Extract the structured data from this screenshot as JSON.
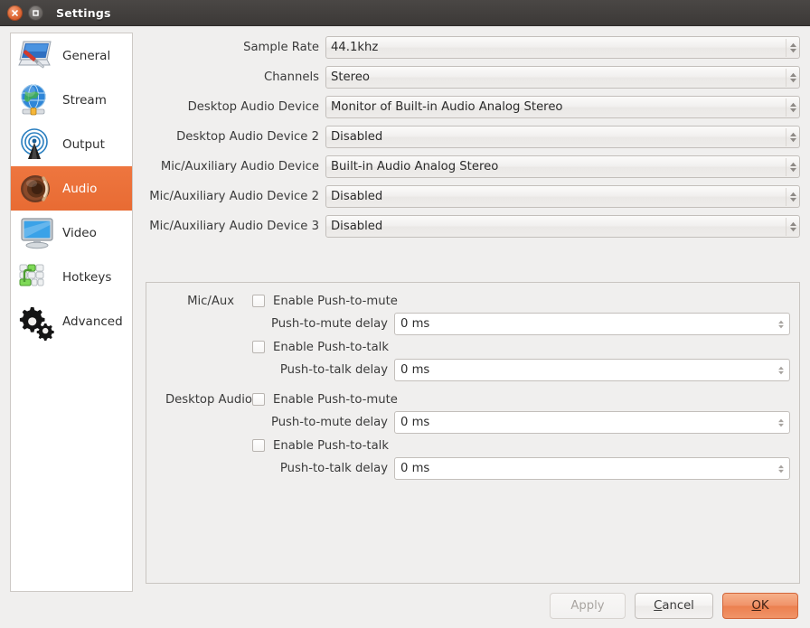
{
  "window": {
    "title": "Settings",
    "close_icon": "close-icon",
    "maximize_icon": "maximize-icon"
  },
  "colors": {
    "accent": "#e8713c",
    "titlebar": "#3c3937",
    "panel_bg": "#f0efee",
    "field_border": "#c3bfbb"
  },
  "sidebar": {
    "items": [
      {
        "label": "General",
        "icon": "general-icon",
        "selected": false
      },
      {
        "label": "Stream",
        "icon": "stream-icon",
        "selected": false
      },
      {
        "label": "Output",
        "icon": "output-icon",
        "selected": false
      },
      {
        "label": "Audio",
        "icon": "audio-icon",
        "selected": true
      },
      {
        "label": "Video",
        "icon": "video-icon",
        "selected": false
      },
      {
        "label": "Hotkeys",
        "icon": "hotkeys-icon",
        "selected": false
      },
      {
        "label": "Advanced",
        "icon": "advanced-icon",
        "selected": false
      }
    ]
  },
  "form": {
    "rows": [
      {
        "label": "Sample Rate",
        "value": "44.1khz"
      },
      {
        "label": "Channels",
        "value": "Stereo"
      },
      {
        "label": "Desktop Audio Device",
        "value": "Monitor of Built-in Audio Analog Stereo"
      },
      {
        "label": "Desktop Audio Device 2",
        "value": "Disabled"
      },
      {
        "label": "Mic/Auxiliary Audio Device",
        "value": "Built-in Audio Analog Stereo"
      },
      {
        "label": "Mic/Auxiliary Audio Device 2",
        "value": "Disabled"
      },
      {
        "label": "Mic/Auxiliary Audio Device 3",
        "value": "Disabled"
      }
    ]
  },
  "groups": [
    {
      "title": "Mic/Aux",
      "push_to_mute": {
        "label": "Enable Push-to-mute",
        "checked": false
      },
      "push_to_mute_delay": {
        "label": "Push-to-mute delay",
        "value": "0 ms"
      },
      "push_to_talk": {
        "label": "Enable Push-to-talk",
        "checked": false
      },
      "push_to_talk_delay": {
        "label": "Push-to-talk delay",
        "value": "0 ms"
      }
    },
    {
      "title": "Desktop Audio",
      "push_to_mute": {
        "label": "Enable Push-to-mute",
        "checked": false
      },
      "push_to_mute_delay": {
        "label": "Push-to-mute delay",
        "value": "0 ms"
      },
      "push_to_talk": {
        "label": "Enable Push-to-talk",
        "checked": false
      },
      "push_to_talk_delay": {
        "label": "Push-to-talk delay",
        "value": "0 ms"
      }
    }
  ],
  "buttons": {
    "apply": {
      "label": "Apply",
      "enabled": false
    },
    "cancel": {
      "label": "Cancel",
      "mnemonic": "C"
    },
    "ok": {
      "label": "OK",
      "mnemonic": "O",
      "primary": true
    }
  }
}
